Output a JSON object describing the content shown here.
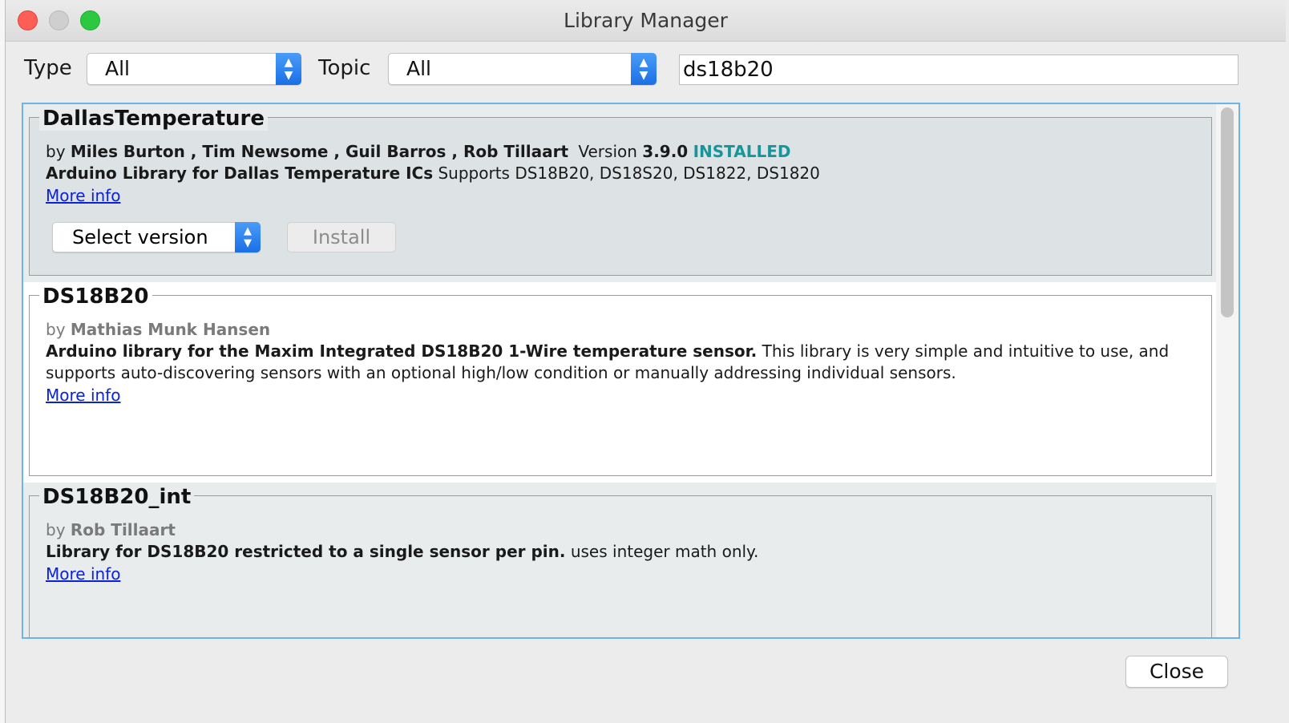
{
  "window": {
    "title": "Library Manager"
  },
  "filters": {
    "type_label": "Type",
    "type_value": "All",
    "topic_label": "Topic",
    "topic_value": "All",
    "search_value": "ds18b20"
  },
  "libraries": [
    {
      "name": "DallasTemperature",
      "by": "by",
      "authors": "Miles Burton , Tim Newsome , Guil Barros , Rob Tillaart",
      "version_label": "Version",
      "version": "3.9.0",
      "status": "INSTALLED",
      "summary": "Arduino Library for Dallas Temperature ICs",
      "description": "Supports DS18B20, DS18S20, DS1822, DS1820",
      "more_info": "More info",
      "select_version": "Select version",
      "install": "Install"
    },
    {
      "name": "DS18B20",
      "by": "by",
      "authors": "Mathias Munk Hansen",
      "summary": "Arduino library for the Maxim Integrated DS18B20 1-Wire temperature sensor.",
      "description_line1": "This library is very simple and intuitive to use, and",
      "description_line2": "supports auto-discovering sensors with an optional high/low condition or manually addressing individual sensors.",
      "more_info": "More info"
    },
    {
      "name": "DS18B20_int",
      "by": "by",
      "authors": "Rob Tillaart",
      "summary": "Library for DS18B20 restricted to a single sensor per pin.",
      "description": "uses integer math only.",
      "more_info": "More info"
    }
  ],
  "footer": {
    "close": "Close"
  },
  "colors": {
    "installed": "#16969a",
    "link": "#0b22d9",
    "accent": "#1a6fe6"
  }
}
